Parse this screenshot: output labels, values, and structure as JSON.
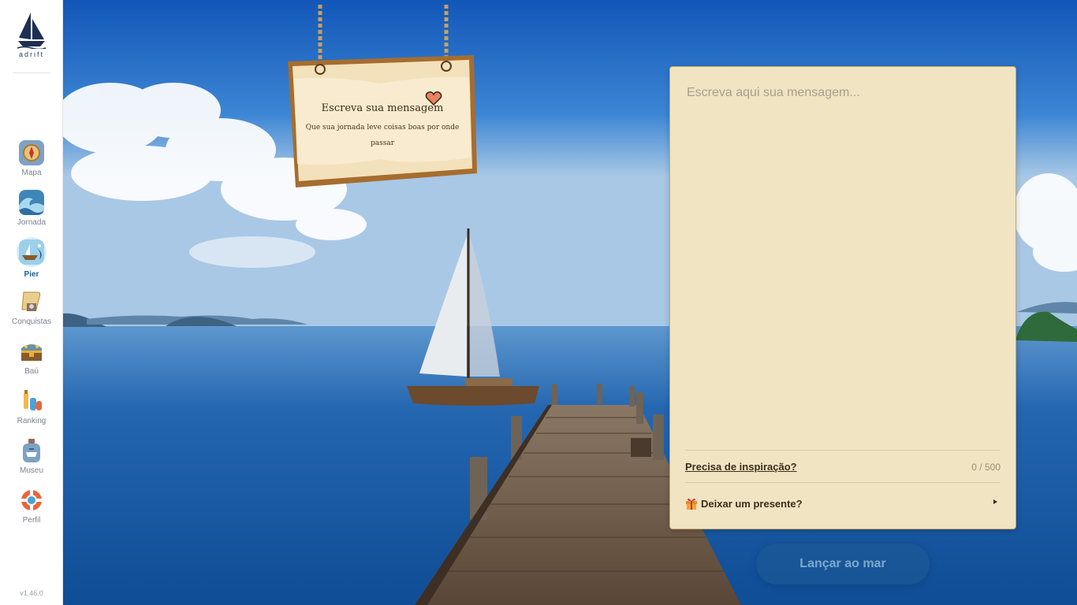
{
  "app": {
    "name": "adrift",
    "version": "v1.46.0"
  },
  "sidebar": {
    "items": [
      {
        "label": "Mapa",
        "icon": "compass-icon"
      },
      {
        "label": "Jornada",
        "icon": "wave-icon"
      },
      {
        "label": "Pier",
        "icon": "boat-wave-icon",
        "active": true
      },
      {
        "label": "Conquistas",
        "icon": "trophy-scroll-icon"
      },
      {
        "label": "Baú",
        "icon": "treasure-chest-icon"
      },
      {
        "label": "Ranking",
        "icon": "bottles-icon"
      },
      {
        "label": "Museu",
        "icon": "bottle-museum-icon"
      },
      {
        "label": "Perfil",
        "icon": "lifebuoy-icon"
      }
    ]
  },
  "sign": {
    "title": "Escreva sua mensagem",
    "subtitle": "Que sua jornada leve coisas boas por onde passar"
  },
  "message": {
    "placeholder": "Escreva aqui sua mensagem...",
    "inspiration_link": "Precisa de inspiração?",
    "counter": "0 / 500",
    "gift_label": "Deixar um presente?"
  },
  "launch_button": "Lançar ao mar",
  "colors": {
    "accent": "#1f5f95",
    "panel_bg": "#f0e4c2",
    "sky_top": "#1b63c2",
    "sea": "#1a5ea8"
  }
}
